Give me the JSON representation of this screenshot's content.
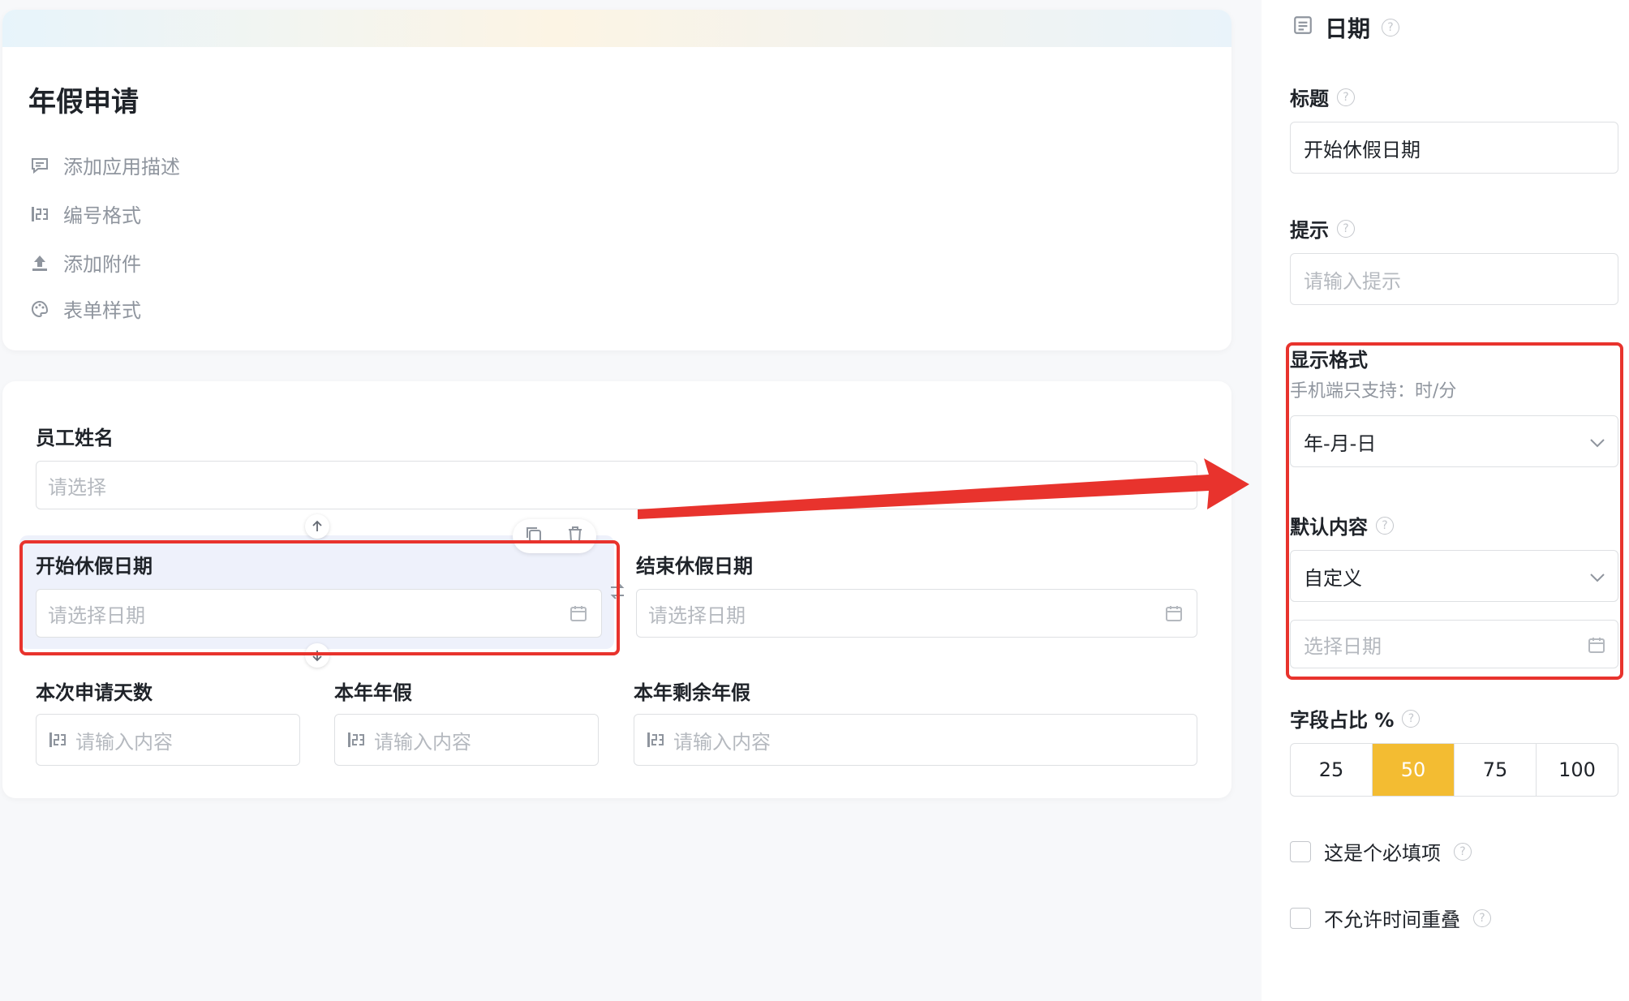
{
  "app": {
    "title": "年假申请",
    "meta_items": [
      {
        "label": "添加应用描述",
        "icon": "comment-icon"
      },
      {
        "label": "编号格式",
        "icon": "number-format-icon"
      },
      {
        "label": "添加附件",
        "icon": "upload-icon"
      },
      {
        "label": "表单样式",
        "icon": "palette-icon"
      }
    ]
  },
  "form": {
    "employee": {
      "label": "员工姓名",
      "placeholder": "请选择"
    },
    "start_date": {
      "label": "开始休假日期",
      "placeholder": "请选择日期"
    },
    "end_date": {
      "label": "结束休假日期",
      "placeholder": "请选择日期"
    },
    "days": {
      "label": "本次申请天数",
      "placeholder": "请输入内容"
    },
    "annual": {
      "label": "本年年假",
      "placeholder": "请输入内容"
    },
    "remaining": {
      "label": "本年剩余年假",
      "placeholder": "请输入内容"
    }
  },
  "panel": {
    "header": "日期",
    "title_label": "标题",
    "title_value": "开始休假日期",
    "hint_label": "提示",
    "hint_placeholder": "请输入提示",
    "format_label": "显示格式",
    "format_sub": "手机端只支持：时/分",
    "format_value": "年-月-日",
    "default_label": "默认内容",
    "default_value": "自定义",
    "default_date_placeholder": "选择日期",
    "ratio_label": "字段占比 %",
    "ratio_options": [
      "25",
      "50",
      "75",
      "100"
    ],
    "ratio_selected": "50",
    "required_label": "这是个必填项",
    "no_overlap_label": "不允许时间重叠"
  },
  "colors": {
    "accent": "#f3bc32",
    "annotation_red": "#e8332d",
    "selected_bg": "#eef1fb"
  }
}
